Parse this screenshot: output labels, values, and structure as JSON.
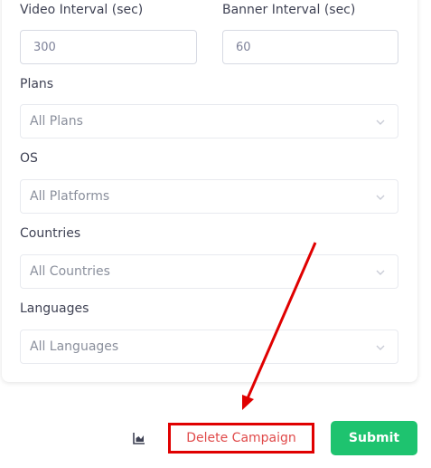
{
  "fields": {
    "video_interval": {
      "label": "Video Interval (sec)",
      "value": "300"
    },
    "banner_interval": {
      "label": "Banner Interval (sec)",
      "value": "60"
    }
  },
  "selects": {
    "plans": {
      "label": "Plans",
      "value": "All Plans",
      "icon": "chevron-down-icon"
    },
    "os": {
      "label": "OS",
      "value": "All Platforms",
      "icon": "chevron-down-icon"
    },
    "countries": {
      "label": "Countries",
      "value": "All Countries",
      "icon": "chevron-down-icon"
    },
    "languages": {
      "label": "Languages",
      "value": "All Languages",
      "icon": "chevron-down-icon"
    }
  },
  "actions": {
    "stats_icon": "bar-chart-icon",
    "delete_label": "Delete Campaign",
    "submit_label": "Submit"
  },
  "colors": {
    "submit_bg": "#1ec36f",
    "delete_text": "#e04a4a",
    "annotation_red": "#e00000"
  }
}
